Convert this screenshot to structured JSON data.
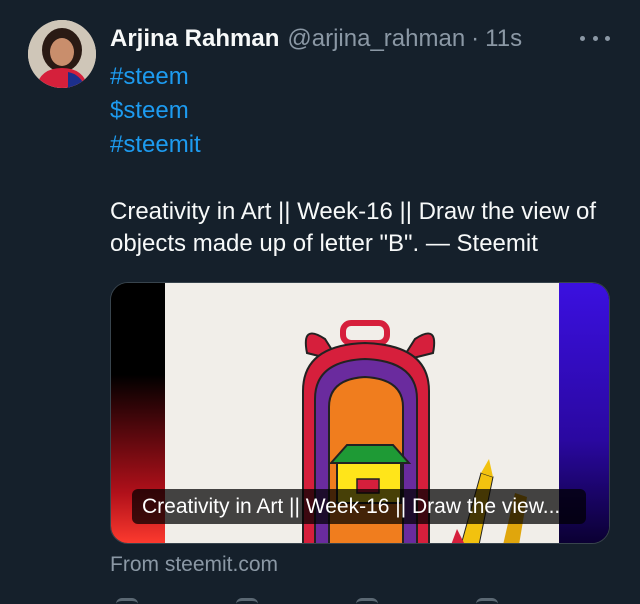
{
  "author": {
    "name": "Arjina Rahman",
    "handle": "@arjina_rahman",
    "separator": "·",
    "time": "11s"
  },
  "tweet": {
    "tags": [
      "#steem",
      "$steem",
      "#steemit"
    ],
    "text": "Creativity in Art || Week-16 || Draw the view of objects made up of letter \"B\". — Steemit"
  },
  "card": {
    "caption": "Creativity in Art || Week-16 || Draw the view...",
    "source": "From steemit.com"
  },
  "icons": {
    "more": "more-horizontal-icon"
  },
  "colors": {
    "background": "#15202b",
    "link": "#1d9bf0",
    "muted": "#8b98a5",
    "text": "#f7f9f9"
  }
}
